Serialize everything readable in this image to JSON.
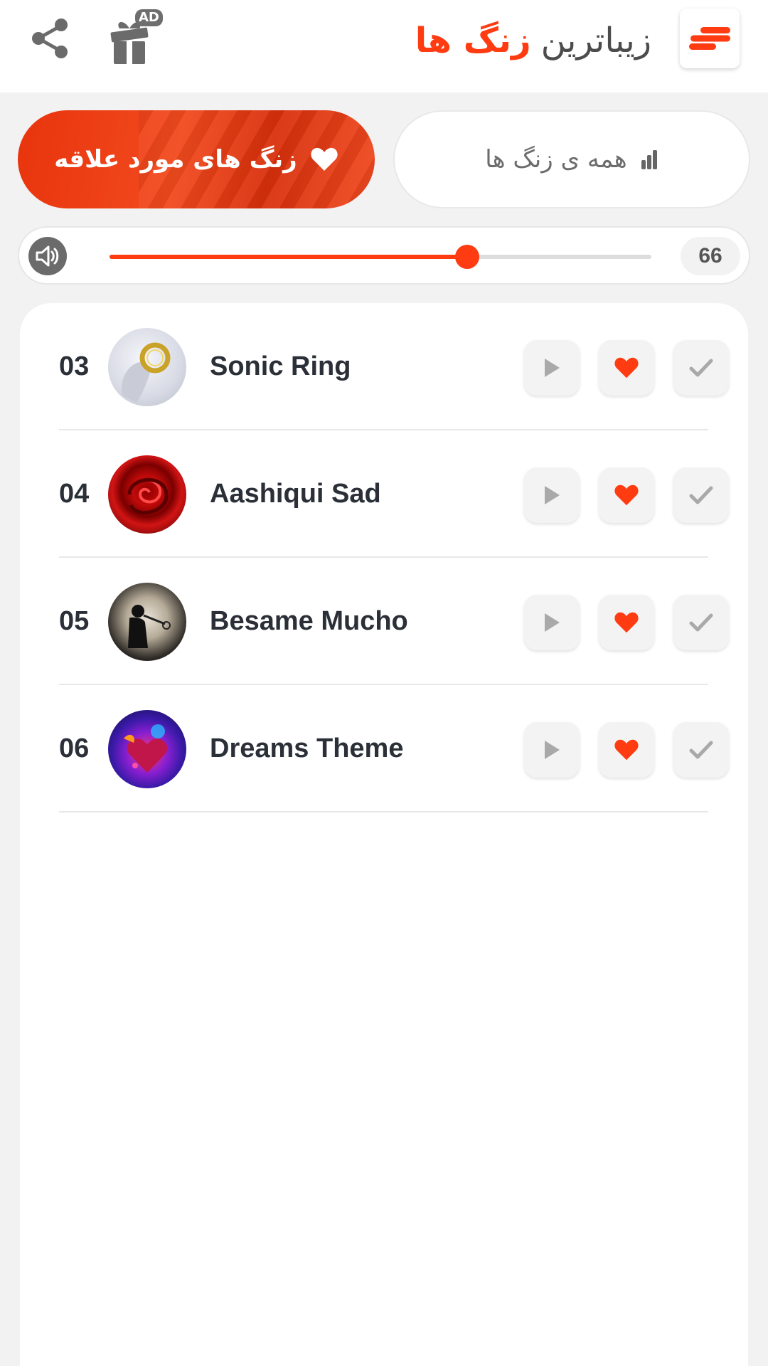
{
  "header": {
    "title_part1": "زیباترین",
    "title_part2": "زنگ ها",
    "ad_badge": "AD",
    "icons": {
      "share": "share-icon",
      "gift": "gift-icon",
      "menu": "menu-icon"
    }
  },
  "tabs": {
    "favorites_label": "زنگ های مورد علاقه",
    "all_label": "همه ی زنگ ها"
  },
  "volume": {
    "value": "66",
    "level_percent": 66
  },
  "ringtones": [
    {
      "number": "03",
      "title": "Sonic Ring"
    },
    {
      "number": "04",
      "title": "Aashiqui Sad"
    },
    {
      "number": "05",
      "title": "Besame Mucho"
    },
    {
      "number": "06",
      "title": "Dreams Theme"
    }
  ],
  "colors": {
    "accent": "#ff3b12",
    "icon_gray": "#6b6b6b",
    "muted_icon": "#a9a9a9"
  }
}
